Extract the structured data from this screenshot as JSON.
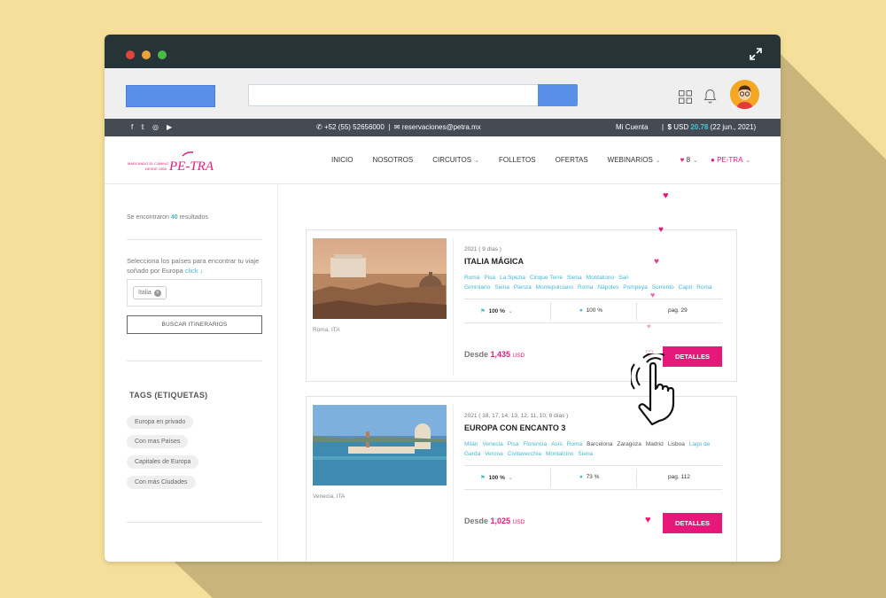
{
  "topbar": {
    "phone": "+52 (55) 52656000",
    "email": "reservaciones@petra.mx",
    "account": "Mi Cuenta",
    "usd_prefix": "USD",
    "usd_value": "20.78",
    "usd_date": "(22 jun., 2021)"
  },
  "logo": {
    "tagline": "MARCANDO EL CAMINO",
    "since": "DESDE 1968",
    "brand": "PE-TRA"
  },
  "nav": {
    "items": [
      "INICIO",
      "NOSOTROS",
      "CIRCUITOS",
      "FOLLETOS",
      "OFERTAS",
      "WEBINARIOS"
    ],
    "fav_count": "8",
    "brand_menu": "PE-TRA"
  },
  "sidebar": {
    "results_prefix": "Se encontraron",
    "results_count": "40",
    "results_suffix": "resultados",
    "select_text": "Selecciona los países para encontrar tu viaje soñado por Europa",
    "click": "click",
    "chip": "Italia",
    "search_button": "BUSCAR ITINERARIOS",
    "tags_title": "TAGS (ETIQUETAS)",
    "tags": [
      "Europa en privado",
      "Con mas Países",
      "Capitales de Europa",
      "Con más Ciudades"
    ]
  },
  "cards": [
    {
      "meta": "2021 ( 9 días )",
      "title": "ITALIA MÁGICA",
      "cities": [
        "Roma",
        "Pisa",
        "La Spezia",
        "Cinque Terre",
        "Siena",
        "Montalcino",
        "San Giminiano",
        "Siena",
        "Pienza",
        "Montepulciano",
        "Roma",
        "Nápoles",
        "Pompeya",
        "Sorrento",
        "Capri",
        "Roma"
      ],
      "flag_pct": "100 %",
      "pin_pct": "100 %",
      "page": "pag. 29",
      "price_label": "Desde",
      "price": "1,435",
      "currency": "USD",
      "location": "Roma, ITA",
      "button": "DETALLES"
    },
    {
      "meta": "2021 ( 18, 17, 14, 13, 12, 11, 10, 8 días )",
      "title": "EUROPA CON ENCANTO 3",
      "cities": [
        "Milán",
        "Venecia",
        "Pisa",
        "Florencia",
        "Asís",
        "Roma",
        "Barcelona",
        "Zaragoza",
        "Madrid",
        "Lisboa",
        "Lago de Garda",
        "Verona",
        "Civitavecchia",
        "Montalcino",
        "Siena"
      ],
      "flag_pct": "100 %",
      "pin_pct": "73 %",
      "page": "pag. 112",
      "price_label": "Desde",
      "price": "1,025",
      "currency": "USD",
      "location": "Venecia, ITA",
      "button": "DETALLES"
    }
  ],
  "colors": {
    "accent": "#e6197a",
    "teal": "#45b8d4",
    "blue": "#5a8fe8",
    "dark": "#263337"
  }
}
